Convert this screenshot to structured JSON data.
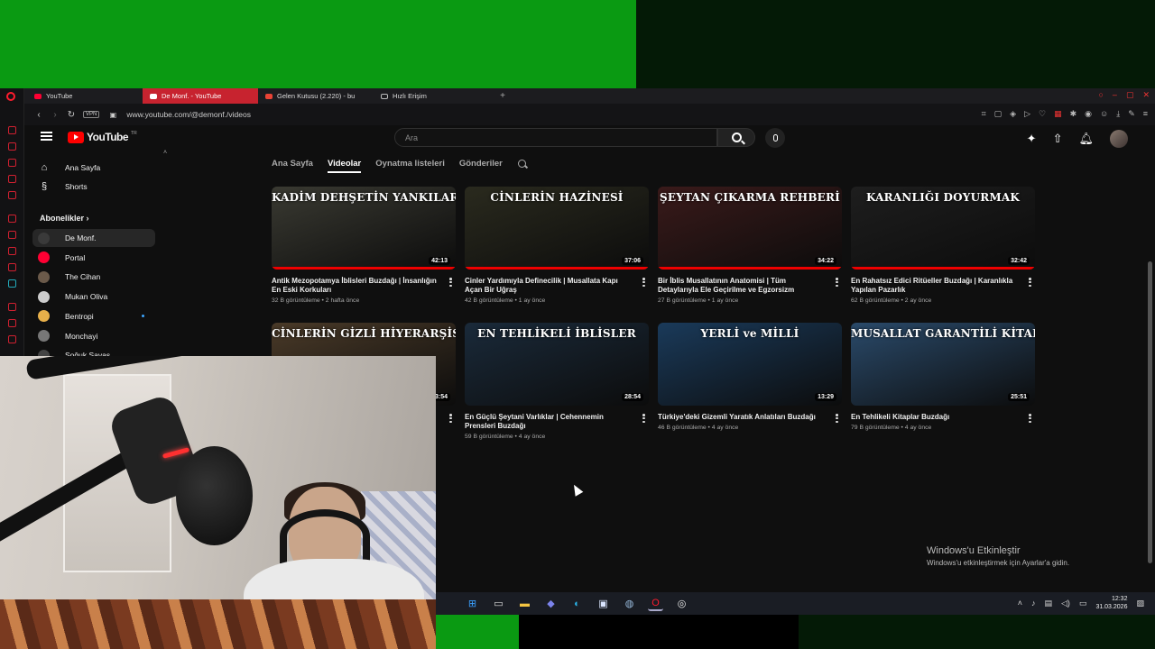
{
  "browser": {
    "tabs": [
      {
        "label": "YouTube",
        "active": false
      },
      {
        "label": "De Monf. - YouTube",
        "active": true
      },
      {
        "label": "Gelen Kutusu (2.220) - bu",
        "active": false
      },
      {
        "label": "Hızlı Erişim",
        "active": false
      }
    ],
    "vpn_label": "VPN",
    "url": "www.youtube.com/@demonf./videos"
  },
  "youtube": {
    "logo_text": "YouTube",
    "logo_suffix": "TR",
    "search_placeholder": "Ara",
    "sidebar": {
      "home": "Ana Sayfa",
      "shorts": "Shorts",
      "subscriptions_heading": "Abonelikler",
      "channels": [
        {
          "name": "De Monf.",
          "selected": true,
          "color": "#3a3a3a"
        },
        {
          "name": "Portal",
          "selected": false,
          "color": "#ff0033"
        },
        {
          "name": "The Cihan",
          "selected": false,
          "color": "#6b5a4a"
        },
        {
          "name": "Mukan Oliva",
          "selected": false,
          "color": "#cccccc"
        },
        {
          "name": "Bentropi",
          "selected": false,
          "color": "#e8b04a",
          "new": true
        },
        {
          "name": "Monchayi",
          "selected": false,
          "color": "#777777"
        },
        {
          "name": "Soğuk Savaş",
          "selected": false,
          "color": "#444444"
        }
      ]
    },
    "channel_tabs": [
      "Ana Sayfa",
      "Videolar",
      "Oynatma listeleri",
      "Gönderiler"
    ],
    "active_tab": "Videolar",
    "videos": [
      {
        "thumb_text": "KADİM DEHŞETİN YANKILARI",
        "duration": "42:13",
        "title": "Antik Mezopotamya İblisleri Buzdağı | İnsanlığın En Eski Korkuları",
        "meta": "32 B görüntüleme • 2 hafta önce",
        "bg": "#3a3a32"
      },
      {
        "thumb_text": "CİNLERİN HAZİNESİ",
        "duration": "37:06",
        "title": "Cinler Yardımıyla Definecilik | Musallata Kapı Açan Bir Uğraş",
        "meta": "42 B görüntüleme • 1 ay önce",
        "bg": "#2a2a1e"
      },
      {
        "thumb_text": "ŞEYTAN ÇIKARMA REHBERİ",
        "duration": "34:22",
        "title": "Bir İblis Musallatının Anatomisi | Tüm Detaylarıyla Ele Geçirilme ve Egzorsizm",
        "meta": "27 B görüntüleme • 1 ay önce",
        "bg": "#3a1a1a"
      },
      {
        "thumb_text": "KARANLIĞI DOYURMAK",
        "duration": "32:42",
        "title": "En Rahatsız Edici Ritüeller Buzdağı | Karanlıkla Yapılan Pazarlık",
        "meta": "62 B görüntüleme • 2 ay önce",
        "bg": "#1e1e1e"
      },
      {
        "thumb_text": "CİNLERİN GİZLİ HİYERARŞİSİ",
        "duration": "3:54",
        "title": "",
        "meta": "",
        "bg": "#4a3a28"
      },
      {
        "thumb_text": "EN TEHLİKELİ İBLİSLER",
        "duration": "28:54",
        "title": "En Güçlü Şeytani Varlıklar | Cehennemin Prensleri Buzdağı",
        "meta": "59 B görüntüleme • 4 ay önce",
        "bg": "#1a2a3a"
      },
      {
        "thumb_text": "YERLİ ve MİLLİ",
        "duration": "13:29",
        "title": "Türkiye'deki Gizemli Yaratık Anlatıları Buzdağı",
        "meta": "46 B görüntüleme • 4 ay önce",
        "bg": "#1a3a5a"
      },
      {
        "thumb_text": "MUSALLAT GARANTİLİ KİTAPLAR",
        "duration": "25:51",
        "title": "En Tehlikeli Kitaplar Buzdağı",
        "meta": "79 B görüntüleme • 4 ay önce",
        "bg": "#2a4a6a"
      }
    ]
  },
  "windows": {
    "activate_title": "Windows'u Etkinleştir",
    "activate_sub": "Windows'u etkinleştirmek için Ayarlar'a gidin.",
    "time": "12:32",
    "date": "31.03.2026"
  }
}
